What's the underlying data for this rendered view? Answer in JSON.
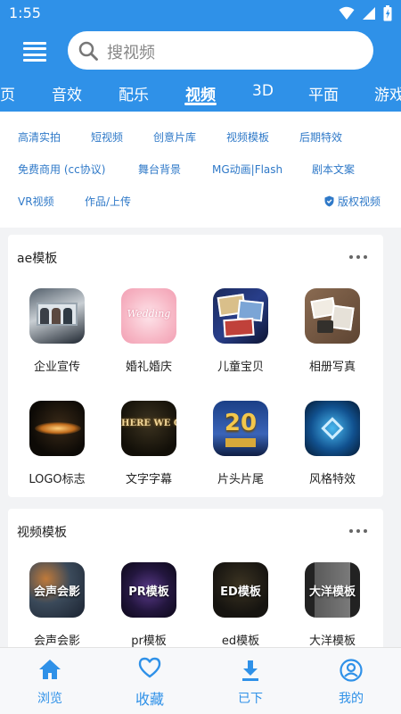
{
  "status_bar": {
    "time": "1:55"
  },
  "search": {
    "placeholder": "搜视频"
  },
  "tabs": [
    "页",
    "音效",
    "配乐",
    "视频",
    "3D",
    "平面",
    "游戏"
  ],
  "active_tab": "视频",
  "tags": {
    "row1": [
      "高清实拍",
      "短视频",
      "创意片库",
      "视频模板",
      "后期特效"
    ],
    "row2": [
      "免费商用 (cc协议)",
      "舞台背景",
      "MG动画|Flash",
      "剧本文案"
    ],
    "row3": [
      "VR视频",
      "作品/上传"
    ],
    "copyright": "版权视频"
  },
  "sections": [
    {
      "title": "ae模板",
      "items": [
        {
          "label": "企业宣传",
          "thumb_text": ""
        },
        {
          "label": "婚礼婚庆",
          "thumb_text": "Wedding"
        },
        {
          "label": "儿童宝贝",
          "thumb_text": ""
        },
        {
          "label": "相册写真",
          "thumb_text": ""
        },
        {
          "label": "LOGO标志",
          "thumb_text": ""
        },
        {
          "label": "文字字幕",
          "thumb_text": "HERE WE GO"
        },
        {
          "label": "片头片尾",
          "thumb_text": "20"
        },
        {
          "label": "风格特效",
          "thumb_text": ""
        }
      ]
    },
    {
      "title": "视频模板",
      "items": [
        {
          "label": "会声会影",
          "thumb_text": "会声会影"
        },
        {
          "label": "pr模板",
          "thumb_text": "PR模板"
        },
        {
          "label": "ed模板",
          "thumb_text": "ED模板"
        },
        {
          "label": "大洋模板",
          "thumb_text": "大洋模板"
        }
      ]
    }
  ],
  "bottom_nav": [
    "浏览",
    "收藏",
    "已下",
    "我的"
  ],
  "colors": {
    "primary": "#2f91e8",
    "tag_text": "#2f79c8"
  }
}
